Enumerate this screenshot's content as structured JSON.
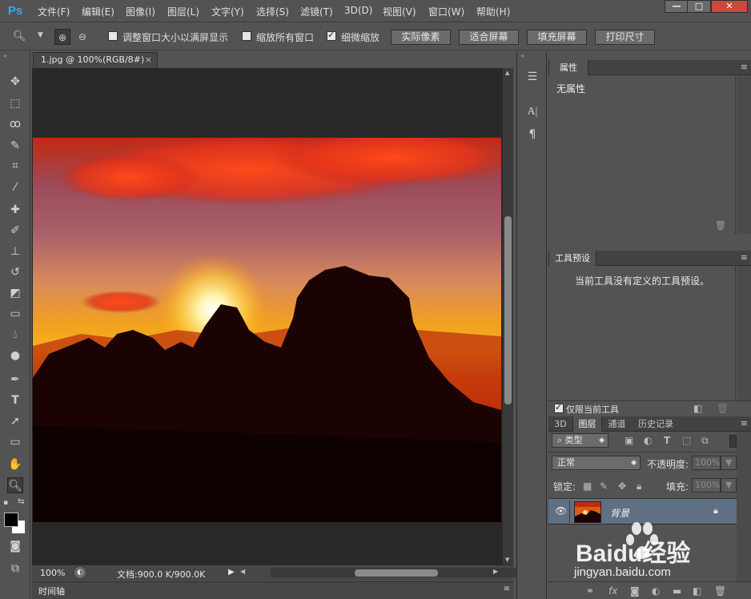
{
  "app": {
    "logo": "Ps"
  },
  "menu": [
    "文件(F)",
    "编辑(E)",
    "图像(I)",
    "图层(L)",
    "文字(Y)",
    "选择(S)",
    "滤镜(T)",
    "3D(D)",
    "视图(V)",
    "窗口(W)",
    "帮助(H)"
  ],
  "window_buttons": {
    "minimize": "—",
    "restore": "□",
    "close": "✕"
  },
  "options": {
    "resize_windows_label": "调整窗口大小以满屏显示",
    "resize_windows_checked": false,
    "zoom_all_label": "缩放所有窗口",
    "zoom_all_checked": false,
    "scrubby_zoom_label": "细微缩放",
    "scrubby_zoom_checked": true,
    "actual_pixels": "实际像素",
    "fit_screen": "适合屏幕",
    "fill_screen": "填充屏幕",
    "print_size": "打印尺寸"
  },
  "document": {
    "tab_title": "1.jpg @ 100%(RGB/8#)",
    "close": "×"
  },
  "status": {
    "zoom": "100%",
    "doc_size": "文档:900.0 K/900.0K"
  },
  "timeline": {
    "label": "时间轴"
  },
  "properties_panel": {
    "tab": "属性",
    "content": "无属性"
  },
  "tool_presets_panel": {
    "tab": "工具预设",
    "content": "当前工具没有定义的工具预设。",
    "current_tool_only_label": "仅限当前工具",
    "current_tool_only_checked": true
  },
  "layers_panel": {
    "tabs": [
      "3D",
      "图层",
      "通道",
      "历史记录"
    ],
    "active_tab": "图层",
    "filter_kind": "类型",
    "blend_mode": "正常",
    "opacity_label": "不透明度:",
    "opacity_value": "100%",
    "lock_label": "锁定:",
    "fill_label": "填充:",
    "fill_value": "100%",
    "layers": [
      {
        "name": "背景",
        "visible": true,
        "locked": true
      }
    ]
  },
  "watermark": {
    "brand": "Baidu经验",
    "url": "jingyan.baidu.com"
  }
}
